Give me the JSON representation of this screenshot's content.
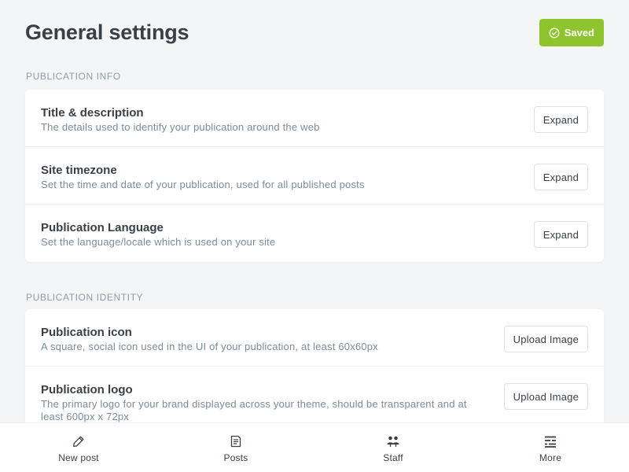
{
  "page": {
    "title": "General settings"
  },
  "header": {
    "saved_label": "Saved",
    "saved_icon": "check-circle-icon",
    "accent_color": "#8ec42e"
  },
  "sections": [
    {
      "label": "PUBLICATION INFO",
      "rows": [
        {
          "title": "Title & description",
          "description": "The details used to identify your publication around the web",
          "button": "Expand"
        },
        {
          "title": "Site timezone",
          "description": "Set the time and date of your publication, used for all published posts",
          "button": "Expand"
        },
        {
          "title": "Publication Language",
          "description": "Set the language/locale which is used on your site",
          "button": "Expand"
        }
      ]
    },
    {
      "label": "PUBLICATION IDENTITY",
      "rows": [
        {
          "title": "Publication icon",
          "description": "A square, social icon used in the UI of your publication, at least 60x60px",
          "button": "Upload Image"
        },
        {
          "title": "Publication logo",
          "description": "The primary logo for your brand displayed across your theme, should be transparent and at least 600px x 72px",
          "button": "Upload Image"
        }
      ]
    }
  ],
  "bottom_nav": [
    {
      "label": "New post",
      "icon": "pencil-icon"
    },
    {
      "label": "Posts",
      "icon": "document-icon"
    },
    {
      "label": "Staff",
      "icon": "people-icon"
    },
    {
      "label": "More",
      "icon": "menu-icon"
    }
  ]
}
